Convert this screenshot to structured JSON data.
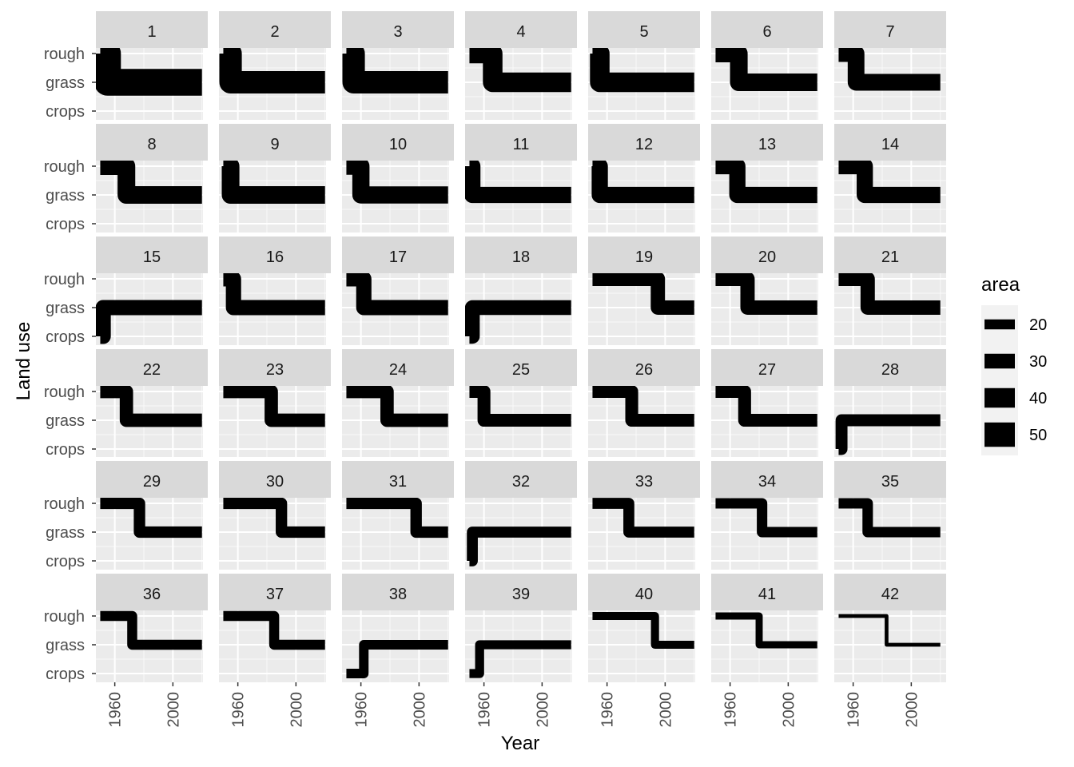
{
  "chart_data": {
    "type": "line",
    "subtype": "faceted step lines (facet_wrap, 7 columns x 6 rows)",
    "title": "",
    "xlabel": "Year",
    "ylabel": "Land use",
    "xlim": [
      1947,
      2024
    ],
    "x_ticks": [
      1960,
      2000
    ],
    "y_categories": [
      "crops",
      "grass",
      "rough"
    ],
    "grid": true,
    "legend": {
      "title": "area",
      "position": "right",
      "mapped_to": "line width",
      "entries": [
        {
          "label": "20",
          "value": 20
        },
        {
          "label": "30",
          "value": 30
        },
        {
          "label": "40",
          "value": 40
        },
        {
          "label": "50",
          "value": 50
        }
      ]
    },
    "x_start": 1950,
    "x_end": 2020,
    "panels": [
      {
        "label": "1",
        "from": "rough",
        "to": "grass",
        "change_year": 1955,
        "area": 55
      },
      {
        "label": "2",
        "from": "rough",
        "to": "grass",
        "change_year": 1955,
        "area": 46
      },
      {
        "label": "3",
        "from": "rough",
        "to": "grass",
        "change_year": 1955,
        "area": 46
      },
      {
        "label": "4",
        "from": "rough",
        "to": "grass",
        "change_year": 1966,
        "area": 40
      },
      {
        "label": "5",
        "from": "rough",
        "to": "grass",
        "change_year": 1955,
        "area": 40
      },
      {
        "label": "6",
        "from": "rough",
        "to": "grass",
        "change_year": 1966,
        "area": 36
      },
      {
        "label": "7",
        "from": "rough",
        "to": "grass",
        "change_year": 1962,
        "area": 34
      },
      {
        "label": "8",
        "from": "rough",
        "to": "grass",
        "change_year": 1968,
        "area": 36
      },
      {
        "label": "9",
        "from": "rough",
        "to": "grass",
        "change_year": 1955,
        "area": 36
      },
      {
        "label": "10",
        "from": "rough",
        "to": "grass",
        "change_year": 1960,
        "area": 35
      },
      {
        "label": "11",
        "from": "rough",
        "to": "grass",
        "change_year": 1952,
        "area": 33
      },
      {
        "label": "12",
        "from": "rough",
        "to": "grass",
        "change_year": 1955,
        "area": 33
      },
      {
        "label": "13",
        "from": "rough",
        "to": "grass",
        "change_year": 1965,
        "area": 33
      },
      {
        "label": "14",
        "from": "rough",
        "to": "grass",
        "change_year": 1968,
        "area": 33
      },
      {
        "label": "15",
        "from": "crops",
        "to": "grass",
        "change_year": 1952,
        "area": 31
      },
      {
        "label": "16",
        "from": "rough",
        "to": "grass",
        "change_year": 1957,
        "area": 31
      },
      {
        "label": "17",
        "from": "rough",
        "to": "grass",
        "change_year": 1962,
        "area": 31
      },
      {
        "label": "18",
        "from": "crops",
        "to": "grass",
        "change_year": 1952,
        "area": 30
      },
      {
        "label": "19",
        "from": "rough",
        "to": "grass",
        "change_year": 1995,
        "area": 29
      },
      {
        "label": "20",
        "from": "rough",
        "to": "grass",
        "change_year": 1972,
        "area": 29
      },
      {
        "label": "21",
        "from": "rough",
        "to": "grass",
        "change_year": 1970,
        "area": 29
      },
      {
        "label": "22",
        "from": "rough",
        "to": "grass",
        "change_year": 1968,
        "area": 27
      },
      {
        "label": "23",
        "from": "rough",
        "to": "grass",
        "change_year": 1983,
        "area": 27
      },
      {
        "label": "24",
        "from": "rough",
        "to": "grass",
        "change_year": 1978,
        "area": 27
      },
      {
        "label": "25",
        "from": "rough",
        "to": "grass",
        "change_year": 1960,
        "area": 26
      },
      {
        "label": "26",
        "from": "rough",
        "to": "grass",
        "change_year": 1977,
        "area": 26
      },
      {
        "label": "27",
        "from": "rough",
        "to": "grass",
        "change_year": 1970,
        "area": 26
      },
      {
        "label": "28",
        "from": "crops",
        "to": "grass",
        "change_year": 1952,
        "area": 24
      },
      {
        "label": "29",
        "from": "rough",
        "to": "grass",
        "change_year": 1977,
        "area": 23
      },
      {
        "label": "30",
        "from": "rough",
        "to": "grass",
        "change_year": 1990,
        "area": 23
      },
      {
        "label": "31",
        "from": "rough",
        "to": "grass",
        "change_year": 1998,
        "area": 23
      },
      {
        "label": "32",
        "from": "crops",
        "to": "grass",
        "change_year": 1952,
        "area": 22
      },
      {
        "label": "33",
        "from": "rough",
        "to": "grass",
        "change_year": 1975,
        "area": 22
      },
      {
        "label": "34",
        "from": "rough",
        "to": "grass",
        "change_year": 1982,
        "area": 21
      },
      {
        "label": "35",
        "from": "rough",
        "to": "grass",
        "change_year": 1970,
        "area": 21
      },
      {
        "label": "36",
        "from": "rough",
        "to": "grass",
        "change_year": 1972,
        "area": 20
      },
      {
        "label": "37",
        "from": "rough",
        "to": "grass",
        "change_year": 1985,
        "area": 20
      },
      {
        "label": "38",
        "from": "crops",
        "to": "grass",
        "change_year": 1962,
        "area": 19
      },
      {
        "label": "39",
        "from": "crops",
        "to": "grass",
        "change_year": 1957,
        "area": 18
      },
      {
        "label": "40",
        "from": "rough",
        "to": "grass",
        "change_year": 1993,
        "area": 16
      },
      {
        "label": "41",
        "from": "rough",
        "to": "grass",
        "change_year": 1980,
        "area": 14
      },
      {
        "label": "42",
        "from": "rough",
        "to": "grass",
        "change_year": 1983,
        "area": 7
      }
    ]
  }
}
